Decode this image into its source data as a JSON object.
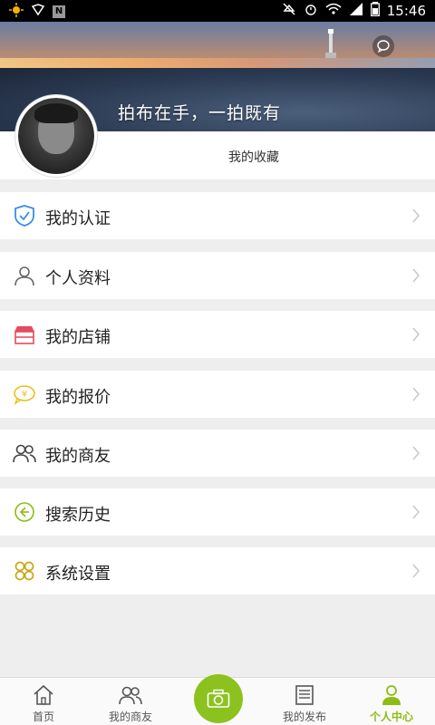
{
  "status_bar": {
    "time": "15:46",
    "badge": "N"
  },
  "hero": {
    "slogan": "拍布在手，一拍既有"
  },
  "profile": {
    "favorites_label": "我的收藏"
  },
  "menu": [
    {
      "label": "我的认证",
      "icon": "shield-check-icon",
      "color": "#3a8ee6"
    },
    {
      "label": "个人资料",
      "icon": "person-icon",
      "color": "#666666"
    },
    {
      "label": "我的店铺",
      "icon": "store-icon",
      "color": "#e8495f"
    },
    {
      "label": "我的报价",
      "icon": "yuan-bubble-icon",
      "color": "#e6c21a"
    },
    {
      "label": "我的商友",
      "icon": "friends-icon",
      "color": "#444444"
    },
    {
      "label": "搜索历史",
      "icon": "history-back-icon",
      "color": "#8cbd14"
    },
    {
      "label": "系统设置",
      "icon": "settings-grid-icon",
      "color": "#c8a614"
    }
  ],
  "bottom_nav": [
    {
      "label": "首页",
      "icon": "home-icon"
    },
    {
      "label": "我的商友",
      "icon": "friends-icon"
    },
    {
      "label": "",
      "icon": "camera-icon"
    },
    {
      "label": "我的发布",
      "icon": "document-icon"
    },
    {
      "label": "个人中心",
      "icon": "person-icon"
    }
  ],
  "colors": {
    "accent": "#8cbd14",
    "background": "#eeeeee"
  }
}
